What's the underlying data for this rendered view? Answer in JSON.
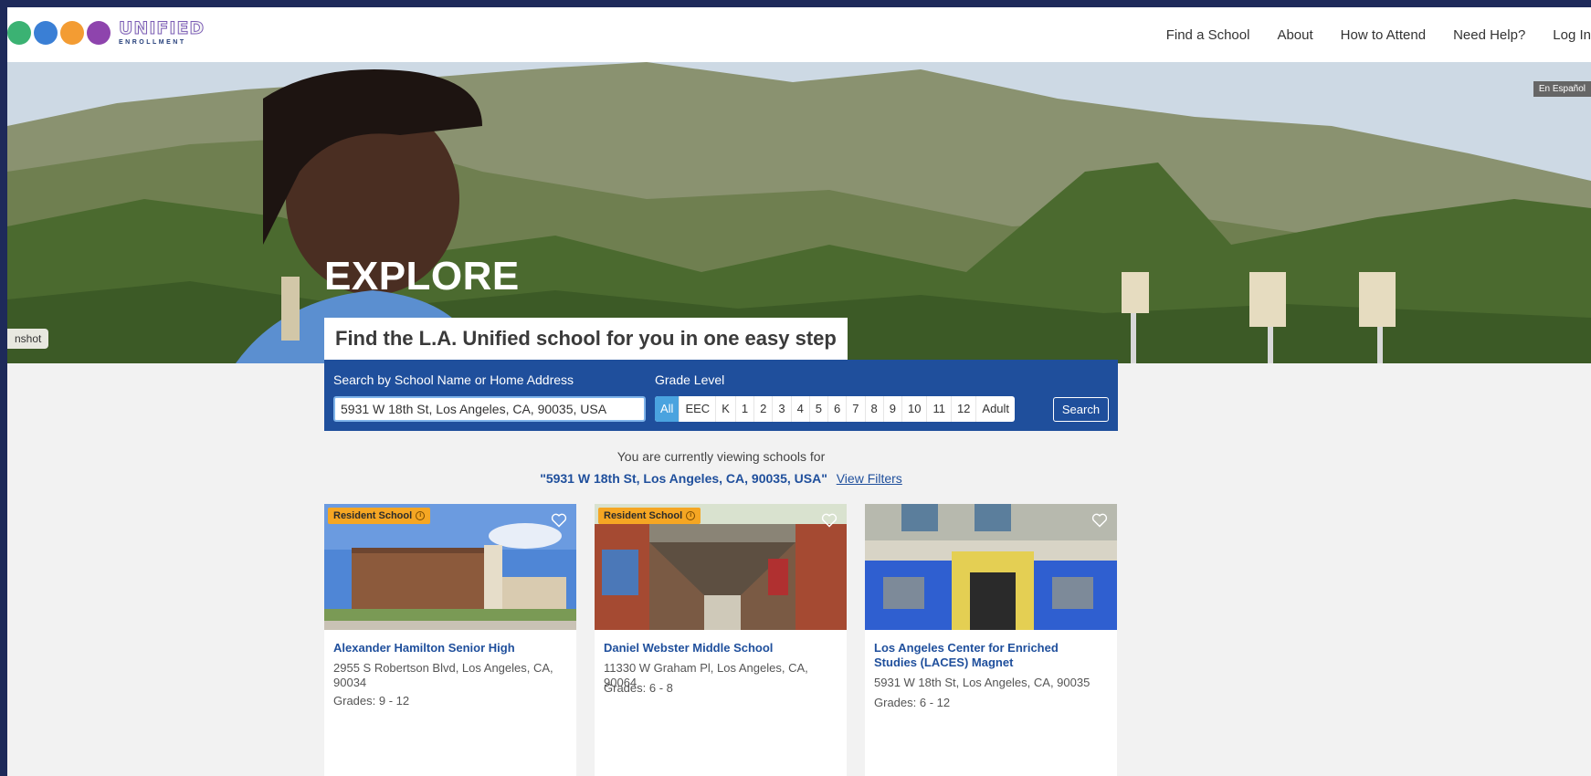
{
  "header": {
    "logo_text": "UNIFIED",
    "logo_sub": "ENROLLMENT",
    "nav": [
      "Find a School",
      "About",
      "How to Attend",
      "Need Help?",
      "Log In"
    ]
  },
  "hero": {
    "language_button": "En Español",
    "snapshot_tab": "nshot",
    "title": "EXPLORE",
    "tagline": "Find the L.A. Unified school for you in one easy step"
  },
  "search": {
    "label": "Search by School Name or Home Address",
    "value": "5931 W 18th St, Los Angeles, CA, 90035, USA",
    "grade_label": "Grade Level",
    "grades": [
      "All",
      "EEC",
      "K",
      "1",
      "2",
      "3",
      "4",
      "5",
      "6",
      "7",
      "8",
      "9",
      "10",
      "11",
      "12",
      "Adult"
    ],
    "selected_grade": "All",
    "button": "Search"
  },
  "results": {
    "viewing_text": "You are currently viewing schools for",
    "address": "\"5931 W 18th St, Los Angeles, CA, 90035, USA\"",
    "filters_link": "View Filters"
  },
  "cards": [
    {
      "badge": "Resident School",
      "name": "Alexander Hamilton Senior High",
      "address": "2955 S Robertson Blvd, Los Angeles, CA, 90034",
      "grades": "Grades: 9 - 12"
    },
    {
      "badge": "Resident School",
      "name": "Daniel Webster Middle School",
      "address": "11330 W Graham Pl, Los Angeles, CA, 90064",
      "grades": "Grades: 6 - 8"
    },
    {
      "badge": "",
      "name": "Los Angeles Center for Enriched Studies (LACES) Magnet",
      "address": "5931 W 18th St, Los Angeles, CA, 90035",
      "grades": "Grades: 6 - 12"
    }
  ],
  "colors": {
    "brand_blue": "#1f4f9c",
    "badge_orange": "#f5a623",
    "active_grade": "#4aa3df"
  }
}
